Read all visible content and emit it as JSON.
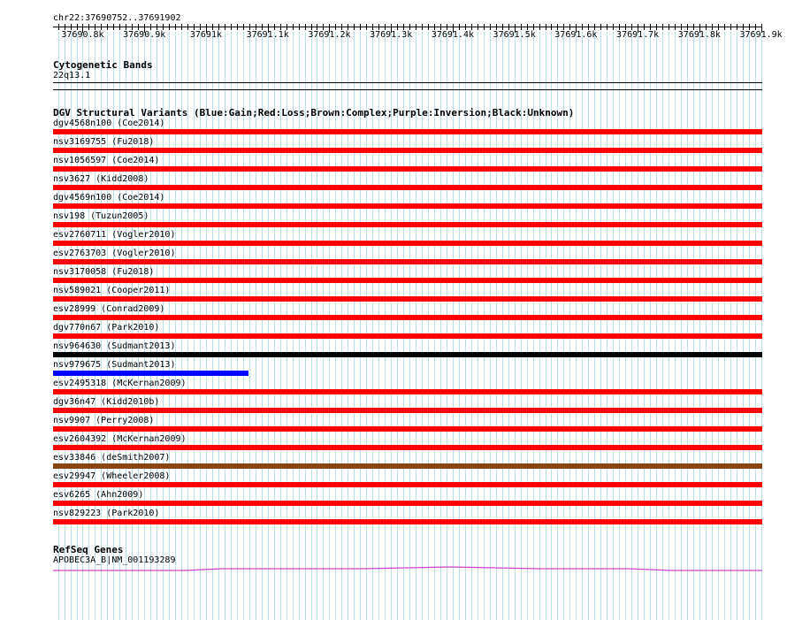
{
  "region": "chr22:37690752..37691902",
  "ruler": {
    "ticks": [
      {
        "label": "37690.8k",
        "pos": 37690800
      },
      {
        "label": "37690.9k",
        "pos": 37690900
      },
      {
        "label": "37691k",
        "pos": 37691000
      },
      {
        "label": "37691.1k",
        "pos": 37691100
      },
      {
        "label": "37691.2k",
        "pos": 37691200
      },
      {
        "label": "37691.3k",
        "pos": 37691300
      },
      {
        "label": "37691.4k",
        "pos": 37691400
      },
      {
        "label": "37691.5k",
        "pos": 37691500
      },
      {
        "label": "37691.6k",
        "pos": 37691600
      },
      {
        "label": "37691.7k",
        "pos": 37691700
      },
      {
        "label": "37691.8k",
        "pos": 37691800
      },
      {
        "label": "37691.9k",
        "pos": 37691900
      }
    ],
    "start": 37690752,
    "end": 37691902
  },
  "cytobands": {
    "title": "Cytogenetic Bands",
    "band": "22q13.1"
  },
  "dgv": {
    "title": "DGV Structural Variants (Blue:Gain;Red:Loss;Brown:Complex;Purple:Inversion;Black:Unknown)",
    "colors": {
      "gain": "#0000ff",
      "loss": "#ff0000",
      "complex": "#8b4513",
      "inversion": "#800080",
      "unknown": "#000000"
    },
    "variants": [
      {
        "label": "dgv4568n100 (Coe2014)",
        "type": "loss",
        "start_frac": 0,
        "end_frac": 1
      },
      {
        "label": "nsv3169755 (Fu2018)",
        "type": "loss",
        "start_frac": 0,
        "end_frac": 1
      },
      {
        "label": "nsv1056597 (Coe2014)",
        "type": "loss",
        "start_frac": 0,
        "end_frac": 1
      },
      {
        "label": "nsv3627 (Kidd2008)",
        "type": "loss",
        "start_frac": 0,
        "end_frac": 1
      },
      {
        "label": "dgv4569n100 (Coe2014)",
        "type": "loss",
        "start_frac": 0,
        "end_frac": 1
      },
      {
        "label": "nsv198 (Tuzun2005)",
        "type": "loss",
        "start_frac": 0,
        "end_frac": 1
      },
      {
        "label": "esv2760711 (Vogler2010)",
        "type": "loss",
        "start_frac": 0,
        "end_frac": 1
      },
      {
        "label": "esv2763703 (Vogler2010)",
        "type": "loss",
        "start_frac": 0,
        "end_frac": 1
      },
      {
        "label": "nsv3170058 (Fu2018)",
        "type": "loss",
        "start_frac": 0,
        "end_frac": 1
      },
      {
        "label": "nsv589021 (Cooper2011)",
        "type": "loss",
        "start_frac": 0,
        "end_frac": 1
      },
      {
        "label": "esv28999 (Conrad2009)",
        "type": "loss",
        "start_frac": 0,
        "end_frac": 1
      },
      {
        "label": "dgv770n67 (Park2010)",
        "type": "loss",
        "start_frac": 0,
        "end_frac": 1
      },
      {
        "label": "nsv964630 (Sudmant2013)",
        "type": "unknown",
        "start_frac": 0,
        "end_frac": 1
      },
      {
        "label": "nsv979675 (Sudmant2013)",
        "type": "gain",
        "start_frac": 0,
        "end_frac": 0.2756
      },
      {
        "label": "esv2495318 (McKernan2009)",
        "type": "loss",
        "start_frac": 0,
        "end_frac": 1
      },
      {
        "label": "dgv36n47 (Kidd2010b)",
        "type": "loss",
        "start_frac": 0,
        "end_frac": 1
      },
      {
        "label": "nsv9907 (Perry2008)",
        "type": "loss",
        "start_frac": 0,
        "end_frac": 1
      },
      {
        "label": "esv2604392 (McKernan2009)",
        "type": "loss",
        "start_frac": 0,
        "end_frac": 1
      },
      {
        "label": "esv33846 (deSmith2007)",
        "type": "complex",
        "start_frac": 0,
        "end_frac": 1
      },
      {
        "label": "esv29947 (Wheeler2008)",
        "type": "loss",
        "start_frac": 0,
        "end_frac": 1
      },
      {
        "label": "esv6265 (Ahn2009)",
        "type": "loss",
        "start_frac": 0,
        "end_frac": 1
      },
      {
        "label": "nsv829223 (Park2010)",
        "type": "loss",
        "start_frac": 0,
        "end_frac": 1
      }
    ]
  },
  "refseq": {
    "title": "RefSeq Genes",
    "gene_label": "APOBEC3A_B|NM_001193289",
    "color": "#cc44cc"
  }
}
